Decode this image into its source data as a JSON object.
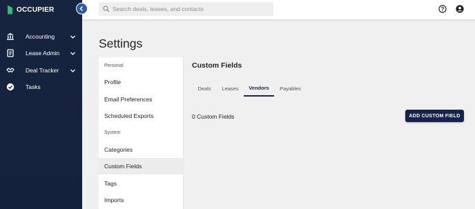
{
  "app": {
    "logo_text": "OCCUPIER",
    "brand_color": "#2fbf73",
    "sidebar_color": "#14213d"
  },
  "sidebar": {
    "collapse_icon": "chevron-left-icon",
    "items": [
      {
        "label": "Accounting",
        "icon": "bank-icon",
        "expandable": true
      },
      {
        "label": "Lease Admin",
        "icon": "document-icon",
        "expandable": true
      },
      {
        "label": "Deal Tracker",
        "icon": "handshake-icon",
        "expandable": true
      },
      {
        "label": "Tasks",
        "icon": "check-circle-icon",
        "expandable": false
      }
    ]
  },
  "topbar": {
    "search_placeholder": "Search deals, leases, and contacts",
    "search_value": "",
    "icons": [
      "help-icon",
      "account-icon"
    ]
  },
  "page": {
    "title": "Settings"
  },
  "settings_menu": {
    "sections": [
      {
        "header": "Personal",
        "items": [
          "Profile",
          "Email Preferences",
          "Scheduled Exports"
        ]
      },
      {
        "header": "System",
        "items": [
          "Categories",
          "Custom Fields",
          "Tags",
          "Imports"
        ]
      }
    ],
    "active_item": "Custom Fields"
  },
  "content": {
    "title": "Custom Fields",
    "tabs": [
      {
        "label": "Deals",
        "active": false
      },
      {
        "label": "Leases",
        "active": false
      },
      {
        "label": "Vendors",
        "active": true
      },
      {
        "label": "Payables",
        "active": false
      }
    ],
    "field_count_text": "0 Custom Fields",
    "add_button_label": "ADD CUSTOM FIELD",
    "accent_color": "#16234a"
  }
}
